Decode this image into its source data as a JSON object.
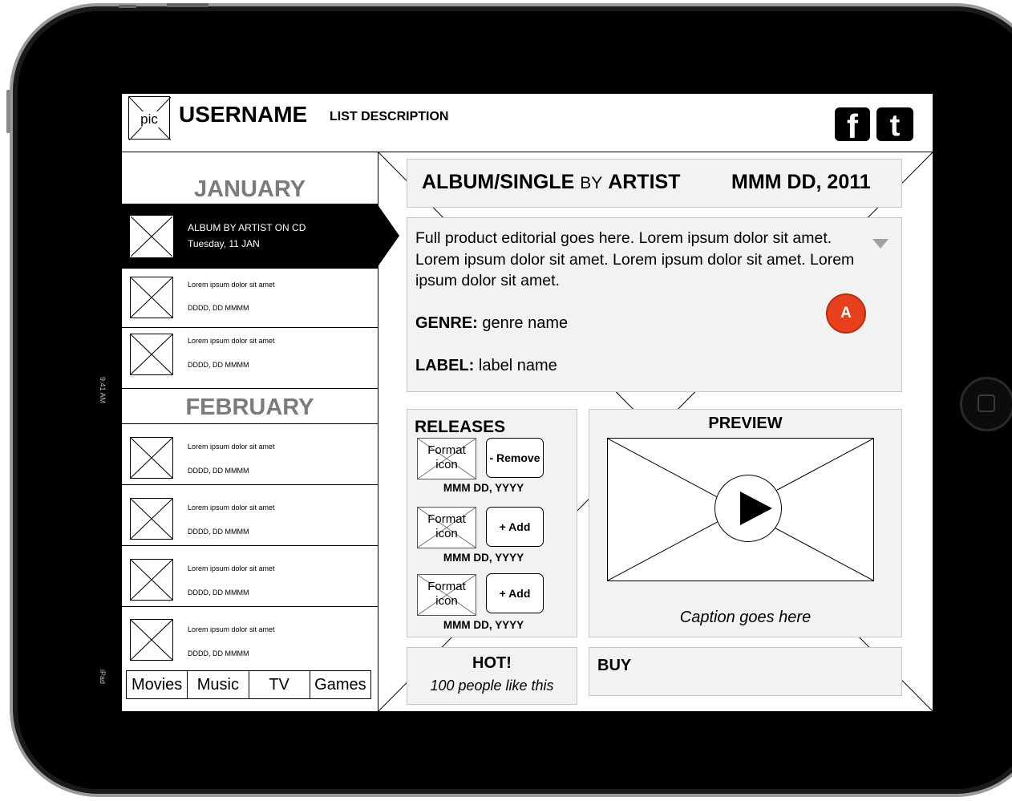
{
  "header": {
    "pic_label": "pic",
    "username": "USERNAME",
    "list_description": "LIST DESCRIPTION",
    "facebook_glyph": "f",
    "twitter_glyph": "t"
  },
  "device_status": {
    "time": "9:41 AM",
    "carrier": "iPad"
  },
  "sidebar": {
    "months": [
      "JANUARY",
      "FEBRUARY"
    ],
    "items": [
      {
        "line1": "ALBUM BY ARTIST ON CD",
        "line2": "Tuesday, 11 JAN",
        "selected": true
      },
      {
        "line1": "Lorem ipsum dolor sit amet",
        "line2": "DDDD, DD MMMM"
      },
      {
        "line1": "Lorem ipsum dolor sit amet",
        "line2": "DDDD, DD MMMM"
      },
      {
        "line1": "Lorem ipsum dolor sit amet",
        "line2": "DDDD, DD MMMM"
      },
      {
        "line1": "Lorem ipsum dolor sit amet",
        "line2": "DDDD, DD MMMM"
      },
      {
        "line1": "Lorem ipsum dolor sit amet",
        "line2": "DDDD, DD MMMM"
      },
      {
        "line1": "Lorem ipsum dolor sit amet",
        "line2": "DDDD, DD MMMM"
      }
    ],
    "tabs": [
      "Movies",
      "Music",
      "TV",
      "Games"
    ]
  },
  "main": {
    "title": {
      "album": "ALBUM/SINGLE",
      "by": "BY",
      "artist": "ARTIST",
      "date": "MMM DD, 2011"
    },
    "editorial": "Full product editorial goes here. Lorem ipsum dolor sit amet. Lorem ipsum dolor sit amet. Lorem ipsum dolor sit amet. Lorem ipsum dolor sit amet.",
    "genre_label": "GENRE:",
    "genre_value": "genre name",
    "label_label": "LABEL:",
    "label_value": "label name",
    "badge": "A",
    "releases": {
      "heading": "RELEASES",
      "items": [
        {
          "format": "Format icon",
          "action": "- Remove",
          "date": "MMM DD, YYYY"
        },
        {
          "format": "Format icon",
          "action": "+ Add",
          "date": "MMM DD, YYYY"
        },
        {
          "format": "Format icon",
          "action": "+ Add",
          "date": "MMM DD, YYYY"
        }
      ]
    },
    "preview": {
      "heading": "PREVIEW",
      "caption": "Caption goes here"
    },
    "hot": {
      "heading": "HOT!",
      "text": "100 people like this"
    },
    "buy": {
      "heading": "BUY"
    }
  },
  "colors": {
    "badge": "#e8401d",
    "panel": "#f2f2f2",
    "month": "#7b7b7b"
  }
}
